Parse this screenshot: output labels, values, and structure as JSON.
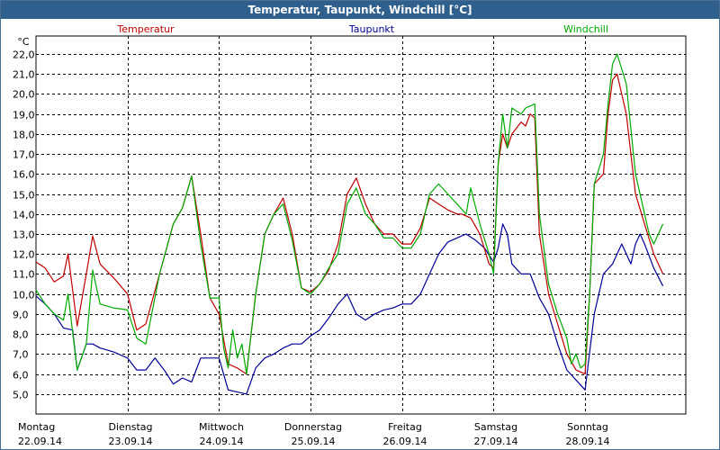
{
  "window": {
    "title": "Temperatur, Taupunkt, Windchill [°C]"
  },
  "chart_data": {
    "type": "line",
    "title": "Temperatur, Taupunkt, Windchill [°C]",
    "ylabel": "°C",
    "ylim": [
      4.0,
      22.9
    ],
    "xlim": [
      0,
      7.1
    ],
    "grid": true,
    "yticks": [
      "5,0",
      "6,0",
      "7,0",
      "8,0",
      "9,0",
      "10,0",
      "11,0",
      "12,0",
      "13,0",
      "14,0",
      "15,0",
      "16,0",
      "17,0",
      "18,0",
      "19,0",
      "20,0",
      "21,0",
      "22,0"
    ],
    "ytick_values": [
      5,
      6,
      7,
      8,
      9,
      10,
      11,
      12,
      13,
      14,
      15,
      16,
      17,
      18,
      19,
      20,
      21,
      22
    ],
    "xticks": [
      {
        "day": "Montag",
        "date": "22.09.14"
      },
      {
        "day": "Dienstag",
        "date": "23.09.14"
      },
      {
        "day": "Mittwoch",
        "date": "24.09.14"
      },
      {
        "day": "Donnerstag",
        "date": "25.09.14"
      },
      {
        "day": "Freitag",
        "date": "26.09.14"
      },
      {
        "day": "Samstag",
        "date": "27.09.14"
      },
      {
        "day": "Sonntag",
        "date": "28.09.14"
      }
    ],
    "series": [
      {
        "name": "Temperatur",
        "color": "#c00000",
        "points": [
          [
            0.0,
            11.6
          ],
          [
            0.1,
            11.3
          ],
          [
            0.2,
            10.6
          ],
          [
            0.3,
            10.9
          ],
          [
            0.35,
            12.0
          ],
          [
            0.45,
            8.4
          ],
          [
            0.55,
            11.0
          ],
          [
            0.62,
            12.9
          ],
          [
            0.7,
            11.5
          ],
          [
            0.85,
            10.8
          ],
          [
            1.0,
            10.0
          ],
          [
            1.1,
            8.2
          ],
          [
            1.2,
            8.5
          ],
          [
            1.35,
            11.0
          ],
          [
            1.5,
            13.5
          ],
          [
            1.6,
            14.3
          ],
          [
            1.7,
            15.9
          ],
          [
            1.8,
            13.0
          ],
          [
            1.9,
            9.8
          ],
          [
            2.0,
            9.0
          ],
          [
            2.1,
            6.5
          ],
          [
            2.2,
            6.3
          ],
          [
            2.3,
            6.0
          ],
          [
            2.4,
            10.0
          ],
          [
            2.5,
            13.0
          ],
          [
            2.6,
            14.0
          ],
          [
            2.7,
            14.8
          ],
          [
            2.8,
            13.0
          ],
          [
            2.9,
            10.3
          ],
          [
            3.0,
            10.1
          ],
          [
            3.1,
            10.5
          ],
          [
            3.2,
            11.2
          ],
          [
            3.3,
            12.5
          ],
          [
            3.4,
            15.0
          ],
          [
            3.5,
            15.8
          ],
          [
            3.6,
            14.5
          ],
          [
            3.7,
            13.5
          ],
          [
            3.8,
            13.0
          ],
          [
            3.9,
            13.0
          ],
          [
            4.0,
            12.5
          ],
          [
            4.1,
            12.5
          ],
          [
            4.2,
            13.3
          ],
          [
            4.3,
            14.8
          ],
          [
            4.4,
            14.5
          ],
          [
            4.5,
            14.2
          ],
          [
            4.6,
            14.0
          ],
          [
            4.65,
            14.0
          ],
          [
            4.75,
            13.8
          ],
          [
            4.85,
            13.0
          ],
          [
            4.95,
            11.5
          ],
          [
            5.0,
            11.3
          ],
          [
            5.05,
            16.5
          ],
          [
            5.1,
            18.0
          ],
          [
            5.15,
            17.3
          ],
          [
            5.2,
            18.0
          ],
          [
            5.3,
            18.6
          ],
          [
            5.35,
            18.4
          ],
          [
            5.4,
            19.0
          ],
          [
            5.45,
            18.8
          ],
          [
            5.5,
            13.0
          ],
          [
            5.6,
            10.0
          ],
          [
            5.7,
            8.5
          ],
          [
            5.8,
            7.0
          ],
          [
            5.9,
            6.2
          ],
          [
            6.0,
            6.0
          ],
          [
            6.05,
            10.0
          ],
          [
            6.1,
            15.5
          ],
          [
            6.2,
            16.0
          ],
          [
            6.25,
            19.0
          ],
          [
            6.3,
            20.7
          ],
          [
            6.35,
            21.0
          ],
          [
            6.45,
            19.0
          ],
          [
            6.55,
            15.0
          ],
          [
            6.65,
            13.5
          ],
          [
            6.75,
            12.0
          ],
          [
            6.85,
            11.0
          ]
        ]
      },
      {
        "name": "Taupunkt",
        "color": "#000099",
        "points": [
          [
            0.0,
            9.9
          ],
          [
            0.1,
            9.5
          ],
          [
            0.2,
            9.0
          ],
          [
            0.3,
            8.3
          ],
          [
            0.4,
            8.2
          ],
          [
            0.45,
            6.2
          ],
          [
            0.55,
            7.5
          ],
          [
            0.62,
            7.5
          ],
          [
            0.7,
            7.3
          ],
          [
            0.85,
            7.1
          ],
          [
            1.0,
            6.8
          ],
          [
            1.1,
            6.2
          ],
          [
            1.2,
            6.2
          ],
          [
            1.3,
            6.8
          ],
          [
            1.4,
            6.2
          ],
          [
            1.5,
            5.5
          ],
          [
            1.6,
            5.8
          ],
          [
            1.7,
            5.6
          ],
          [
            1.8,
            6.8
          ],
          [
            1.9,
            6.8
          ],
          [
            2.0,
            6.8
          ],
          [
            2.1,
            5.2
          ],
          [
            2.2,
            5.1
          ],
          [
            2.3,
            5.0
          ],
          [
            2.4,
            6.3
          ],
          [
            2.5,
            6.8
          ],
          [
            2.6,
            7.0
          ],
          [
            2.7,
            7.3
          ],
          [
            2.8,
            7.5
          ],
          [
            2.9,
            7.5
          ],
          [
            3.0,
            7.9
          ],
          [
            3.1,
            8.2
          ],
          [
            3.2,
            8.8
          ],
          [
            3.3,
            9.5
          ],
          [
            3.4,
            10.0
          ],
          [
            3.5,
            9.0
          ],
          [
            3.6,
            8.7
          ],
          [
            3.7,
            9.0
          ],
          [
            3.8,
            9.2
          ],
          [
            3.9,
            9.3
          ],
          [
            4.0,
            9.5
          ],
          [
            4.1,
            9.5
          ],
          [
            4.2,
            10.0
          ],
          [
            4.3,
            11.0
          ],
          [
            4.4,
            12.0
          ],
          [
            4.5,
            12.6
          ],
          [
            4.6,
            12.8
          ],
          [
            4.7,
            13.0
          ],
          [
            4.8,
            12.7
          ],
          [
            4.9,
            12.3
          ],
          [
            5.0,
            11.6
          ],
          [
            5.05,
            12.3
          ],
          [
            5.1,
            13.5
          ],
          [
            5.15,
            13.0
          ],
          [
            5.2,
            11.5
          ],
          [
            5.3,
            11.0
          ],
          [
            5.4,
            11.0
          ],
          [
            5.5,
            9.8
          ],
          [
            5.6,
            9.0
          ],
          [
            5.7,
            7.5
          ],
          [
            5.8,
            6.2
          ],
          [
            5.9,
            5.7
          ],
          [
            6.0,
            5.2
          ],
          [
            6.1,
            9.0
          ],
          [
            6.2,
            11.0
          ],
          [
            6.3,
            11.5
          ],
          [
            6.4,
            12.5
          ],
          [
            6.5,
            11.5
          ],
          [
            6.55,
            12.5
          ],
          [
            6.6,
            13.0
          ],
          [
            6.65,
            12.5
          ],
          [
            6.75,
            11.3
          ],
          [
            6.85,
            10.4
          ]
        ]
      },
      {
        "name": "Windchill",
        "color": "#00aa00",
        "points": [
          [
            0.0,
            10.2
          ],
          [
            0.1,
            9.5
          ],
          [
            0.2,
            9.0
          ],
          [
            0.3,
            8.7
          ],
          [
            0.35,
            10.0
          ],
          [
            0.45,
            6.2
          ],
          [
            0.55,
            7.5
          ],
          [
            0.62,
            11.2
          ],
          [
            0.7,
            9.5
          ],
          [
            0.85,
            9.3
          ],
          [
            1.0,
            9.2
          ],
          [
            1.1,
            7.8
          ],
          [
            1.2,
            7.5
          ],
          [
            1.35,
            11.0
          ],
          [
            1.5,
            13.5
          ],
          [
            1.6,
            14.3
          ],
          [
            1.7,
            15.9
          ],
          [
            1.8,
            12.5
          ],
          [
            1.9,
            9.8
          ],
          [
            2.0,
            9.8
          ],
          [
            2.05,
            7.3
          ],
          [
            2.1,
            6.3
          ],
          [
            2.15,
            8.2
          ],
          [
            2.2,
            6.8
          ],
          [
            2.25,
            7.5
          ],
          [
            2.3,
            6.0
          ],
          [
            2.4,
            10.0
          ],
          [
            2.5,
            13.0
          ],
          [
            2.6,
            14.0
          ],
          [
            2.7,
            14.5
          ],
          [
            2.8,
            12.7
          ],
          [
            2.9,
            10.3
          ],
          [
            3.0,
            10.0
          ],
          [
            3.1,
            10.5
          ],
          [
            3.2,
            11.3
          ],
          [
            3.3,
            12.0
          ],
          [
            3.4,
            14.5
          ],
          [
            3.5,
            15.3
          ],
          [
            3.6,
            14.0
          ],
          [
            3.7,
            13.5
          ],
          [
            3.8,
            12.8
          ],
          [
            3.9,
            12.8
          ],
          [
            4.0,
            12.3
          ],
          [
            4.1,
            12.3
          ],
          [
            4.2,
            13.0
          ],
          [
            4.3,
            15.0
          ],
          [
            4.4,
            15.5
          ],
          [
            4.5,
            15.0
          ],
          [
            4.6,
            14.5
          ],
          [
            4.7,
            14.0
          ],
          [
            4.75,
            15.3
          ],
          [
            4.85,
            13.5
          ],
          [
            4.95,
            12.0
          ],
          [
            5.0,
            11.0
          ],
          [
            5.05,
            16.5
          ],
          [
            5.1,
            19.0
          ],
          [
            5.15,
            17.3
          ],
          [
            5.2,
            19.3
          ],
          [
            5.3,
            19.0
          ],
          [
            5.35,
            19.3
          ],
          [
            5.45,
            19.5
          ],
          [
            5.5,
            14.0
          ],
          [
            5.6,
            10.5
          ],
          [
            5.7,
            9.0
          ],
          [
            5.8,
            7.8
          ],
          [
            5.85,
            6.5
          ],
          [
            5.9,
            7.0
          ],
          [
            5.95,
            6.3
          ],
          [
            6.0,
            6.5
          ],
          [
            6.05,
            10.0
          ],
          [
            6.1,
            15.5
          ],
          [
            6.2,
            17.0
          ],
          [
            6.25,
            19.5
          ],
          [
            6.3,
            21.5
          ],
          [
            6.35,
            22.0
          ],
          [
            6.45,
            20.5
          ],
          [
            6.55,
            16.0
          ],
          [
            6.65,
            14.0
          ],
          [
            6.7,
            13.0
          ],
          [
            6.75,
            12.5
          ],
          [
            6.8,
            13.0
          ],
          [
            6.85,
            13.5
          ]
        ]
      }
    ]
  }
}
